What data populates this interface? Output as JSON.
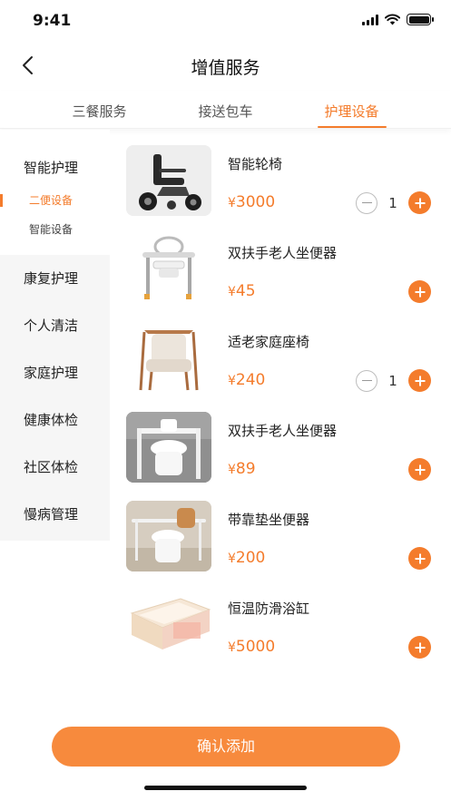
{
  "status": {
    "time": "9:41"
  },
  "nav": {
    "title": "增值服务"
  },
  "tabs": [
    {
      "label": "三餐服务",
      "active": false
    },
    {
      "label": "接送包车",
      "active": false
    },
    {
      "label": "护理设备",
      "active": true
    }
  ],
  "sidebar": {
    "group": {
      "label": "智能护理",
      "subs": [
        "二便设备",
        "智能设备"
      ],
      "active_sub": "二便设备"
    },
    "items": [
      "康复护理",
      "个人清洁",
      "家庭护理",
      "健康体检",
      "社区体检",
      "慢病管理"
    ]
  },
  "products": [
    {
      "name": "智能轮椅",
      "currency": "¥",
      "price": "3000",
      "quantity": "1",
      "image": "wheelchair"
    },
    {
      "name": "双扶手老人坐便器",
      "currency": "¥",
      "price": "45",
      "quantity": "",
      "image": "commode-frame"
    },
    {
      "name": "适老家庭座椅",
      "currency": "¥",
      "price": "240",
      "quantity": "1",
      "image": "armchair"
    },
    {
      "name": "双扶手老人坐便器",
      "currency": "¥",
      "price": "89",
      "quantity": "",
      "image": "toilet-rails"
    },
    {
      "name": "带靠垫坐便器",
      "currency": "¥",
      "price": "200",
      "quantity": "",
      "image": "backrest-toilet"
    },
    {
      "name": "恒温防滑浴缸",
      "currency": "¥",
      "price": "5000",
      "quantity": "",
      "image": "bathtub"
    }
  ],
  "confirm_label": "确认添加",
  "colors": {
    "accent": "#f47c2c",
    "button": "#f78a3d",
    "sidebar_bg": "#f6f6f6"
  }
}
